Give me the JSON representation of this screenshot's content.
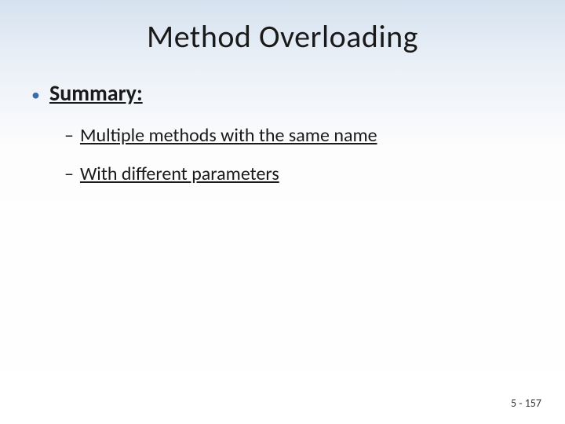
{
  "title": "Method Overloading",
  "summary_label": "Summary:",
  "points": {
    "p1": "Multiple methods with the same name",
    "p2": "With different parameters"
  },
  "page_number": "5 - 157"
}
